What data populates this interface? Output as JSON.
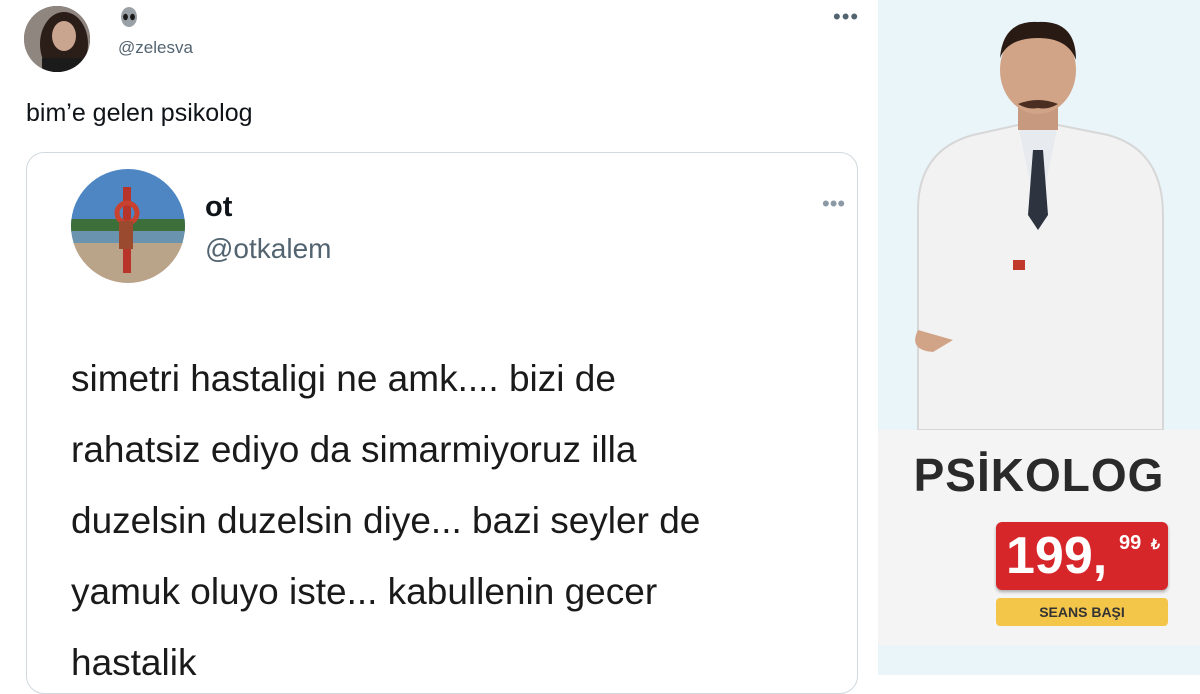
{
  "tweet": {
    "handle": "@zelesva",
    "text": "bim’e gelen psikolog",
    "more_label": "•••"
  },
  "quoted_tweet": {
    "name": "ot",
    "handle": "@otkalem",
    "more_label": "•••",
    "body": "simetri hastaligi ne amk.... bizi de\nrahatsiz ediyo da simarmiyoruz illa\nduzelsin duzelsin diye... bazi seyler de\nyamuk oluyo iste... kabullenin gecer\nhastalik"
  },
  "ad": {
    "title": "PSİKOLOG",
    "price_main": "199,",
    "price_cents": "99",
    "currency": "₺",
    "session_label": "SEANS BAŞI",
    "price_color": "#d7262a",
    "label_color": "#f3c64a"
  },
  "icons": [
    "alien-icon",
    "more-icon"
  ]
}
